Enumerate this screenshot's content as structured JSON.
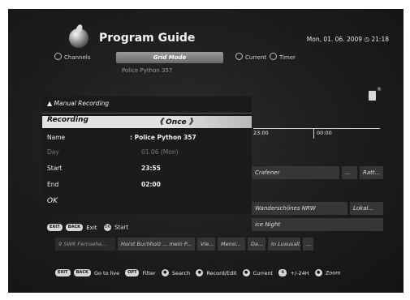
{
  "header": {
    "title": "Program Guide",
    "datetime": "Mon, 01. 06. 2009   ◷ 21:18"
  },
  "modes": {
    "channels": "Channels",
    "grid": "Grid Mode",
    "current": "Current",
    "timer": "Timer"
  },
  "program_top": "Police Python 357",
  "grid": {
    "times": [
      "23:00",
      "00:00"
    ],
    "rows": [
      {
        "cells": [
          "Crafener",
          "...",
          "Ratt..."
        ]
      },
      {
        "cells": [
          "Wanderschönes NRW",
          "Lokal..."
        ]
      },
      {
        "cells": [
          "ice Night"
        ]
      }
    ]
  },
  "bottom_row": [
    "9 SWR Fernsehe...",
    "Horst Buchholz ... mein P...",
    "Vie...",
    "Mensi...",
    "Da...",
    "In Luxusall...",
    "..."
  ],
  "dialog": {
    "title": "Manual Recording",
    "recording_label": "Recording",
    "recording_value": "《  Once  》",
    "name_label": "Name",
    "name_value": ":   Police Python 357",
    "day_label": "Day",
    "day_value": "01.06 (Mon)",
    "start_label": "Start",
    "start_value": "23:55",
    "end_label": "End",
    "end_value": "02:00",
    "ok_label": "OK"
  },
  "dialog_footer": {
    "exit_keys": [
      "EXIT",
      "BACK"
    ],
    "exit_label": "Exit",
    "ok_key": "OK",
    "start_label": "Start"
  },
  "legend": {
    "go_live_keys": [
      "EXIT",
      "BACK"
    ],
    "go_live": "Go to live",
    "filter_key": "OPT",
    "filter": "Filter",
    "search": "Search",
    "record_edit": "Record/Edit",
    "current": "Current",
    "time_shift": "+/-24H",
    "zoom": "Zoom"
  }
}
